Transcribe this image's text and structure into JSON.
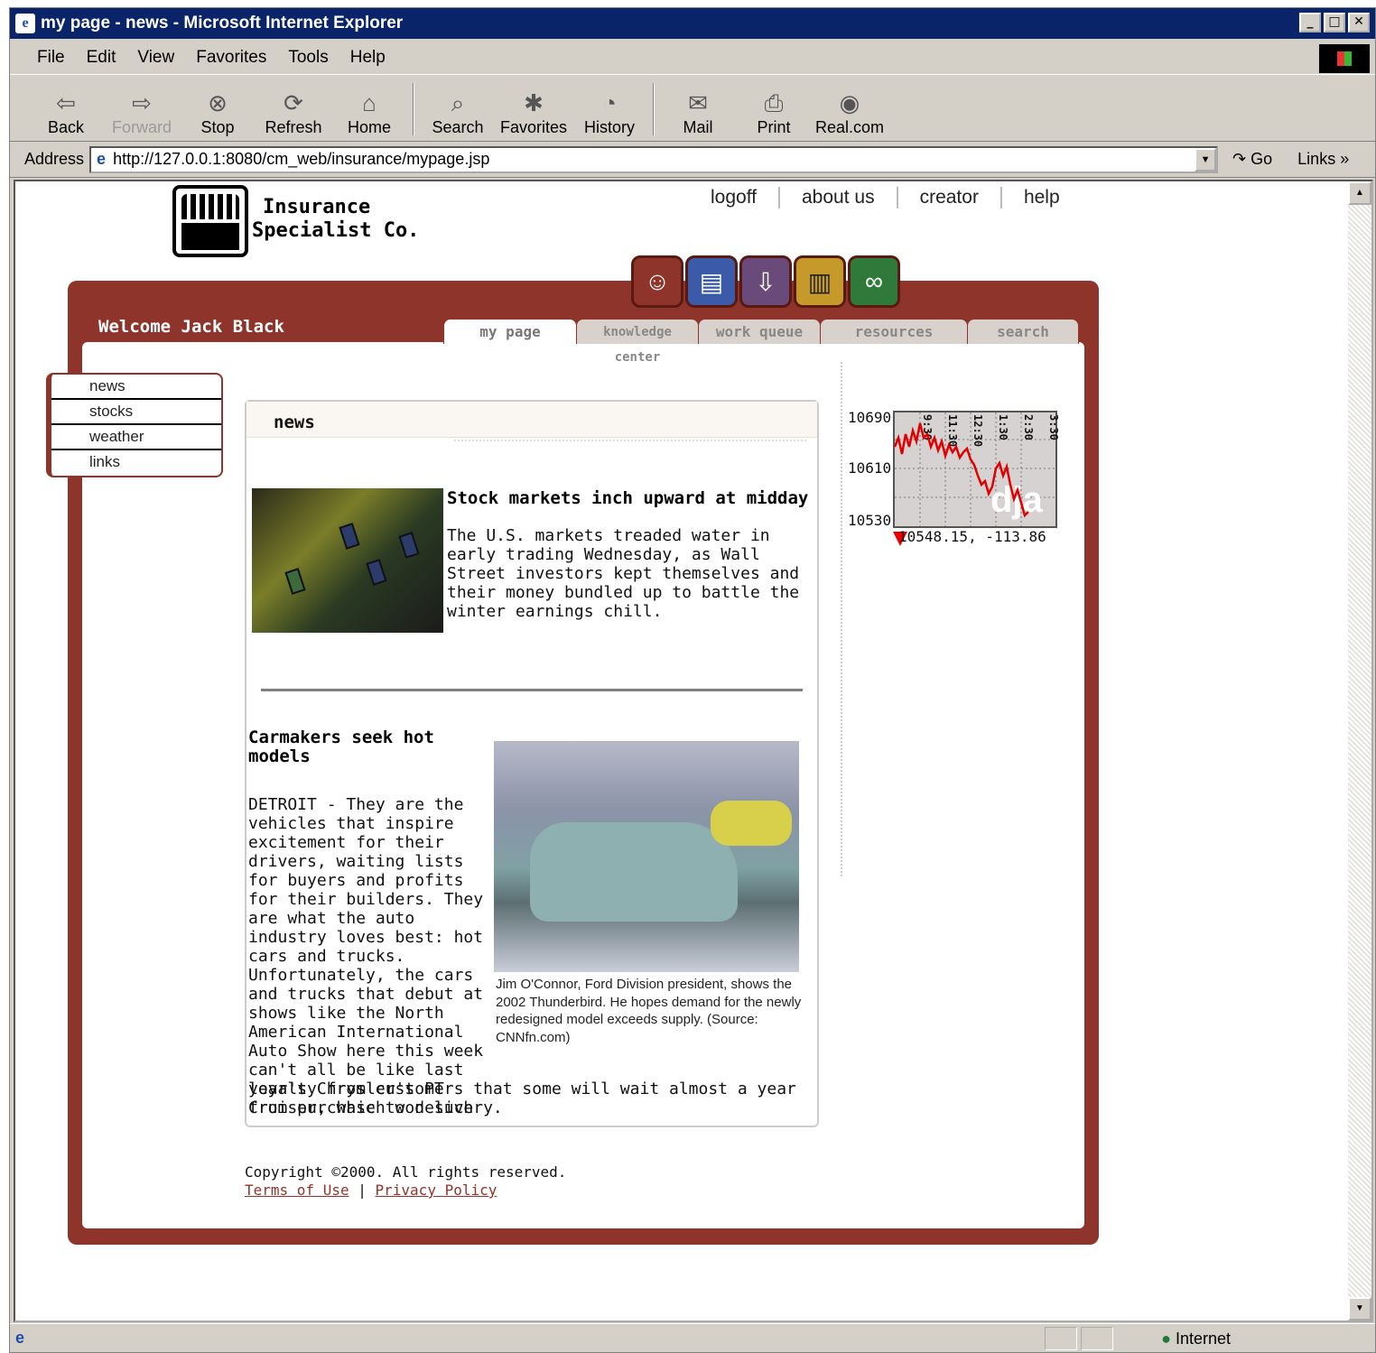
{
  "window": {
    "title": "my page - news - Microsoft Internet Explorer"
  },
  "menu": [
    "File",
    "Edit",
    "View",
    "Favorites",
    "Tools",
    "Help"
  ],
  "toolbar": [
    {
      "label": "Back",
      "icon": "back-arrow-icon",
      "enabled": true
    },
    {
      "label": "Forward",
      "icon": "forward-arrow-icon",
      "enabled": false
    },
    {
      "label": "Stop",
      "icon": "stop-icon",
      "enabled": true
    },
    {
      "label": "Refresh",
      "icon": "refresh-icon",
      "enabled": true
    },
    {
      "label": "Home",
      "icon": "home-icon",
      "enabled": true
    },
    {
      "label": "Search",
      "icon": "search-icon",
      "enabled": true
    },
    {
      "label": "Favorites",
      "icon": "favorites-icon",
      "enabled": true
    },
    {
      "label": "History",
      "icon": "history-icon",
      "enabled": true
    },
    {
      "label": "Mail",
      "icon": "mail-icon",
      "enabled": true
    },
    {
      "label": "Print",
      "icon": "print-icon",
      "enabled": true
    },
    {
      "label": "Real.com",
      "icon": "real-icon",
      "enabled": true
    }
  ],
  "address": {
    "label": "Address",
    "url": "http://127.0.0.1:8080/cm_web/insurance/mypage.jsp",
    "go": "Go",
    "links": "Links"
  },
  "status": {
    "zone": "Internet"
  },
  "site": {
    "company_line1": "Insurance",
    "company_line2": "Specialist Co.",
    "top_links": [
      "logoff",
      "about us",
      "creator",
      "help"
    ],
    "welcome": "Welcome Jack Black",
    "tabs": [
      "my page",
      "knowledge center",
      "work queue",
      "resources",
      "search"
    ],
    "active_tab": "my page",
    "side_nav": [
      "news",
      "stocks",
      "weather",
      "links"
    ],
    "icon_buttons": [
      {
        "name": "profile-face-icon",
        "color": "#8f342a"
      },
      {
        "name": "documents-icon",
        "color": "#3b5aa8"
      },
      {
        "name": "inbox-download-icon",
        "color": "#6a4a7a"
      },
      {
        "name": "library-books-icon",
        "color": "#c59a2a"
      },
      {
        "name": "binoculars-icon",
        "color": "#2f7a3a"
      }
    ]
  },
  "news": {
    "header": "news",
    "story1": {
      "headline": "Stock markets inch upward at midday",
      "body": "The U.S. markets treaded water in early trading Wednesday, as Wall Street investors kept themselves and their money bundled up to battle the winter earnings chill."
    },
    "story2": {
      "headline": "Carmakers seek hot models",
      "body_wrapped": "DETROIT - They are the vehicles that inspire excitement for their drivers, waiting lists for buyers and profits for their builders. They are what the auto industry loves best: hot cars and trucks. Unfortunately, the cars and trucks that debut at shows like the North American International Auto Show here this week can't all be like last year's Chrysler's PT Cruiser, which won such",
      "body_full": "loyalty from customers that some will wait almost a year from purchase to delivery.",
      "caption": "Jim O'Connor, Ford Division president, shows the 2002 Thunderbird. He hopes demand for the newly redesigned model exceeds supply. (Source: CNNfn.com)"
    }
  },
  "ticker": {
    "y_labels": [
      "10690",
      "10610",
      "10530"
    ],
    "time_labels": [
      "9:30",
      "11:30",
      "12:30",
      "1:30",
      "2:30",
      "3:30"
    ],
    "quote": "10548.15, -113.86",
    "watermark": "dja",
    "line_color": "#e00000"
  },
  "footer": {
    "copyright": "Copyright ©2000. All rights reserved.",
    "terms": "Terms of Use",
    "sep": "|",
    "privacy": "Privacy Policy"
  }
}
